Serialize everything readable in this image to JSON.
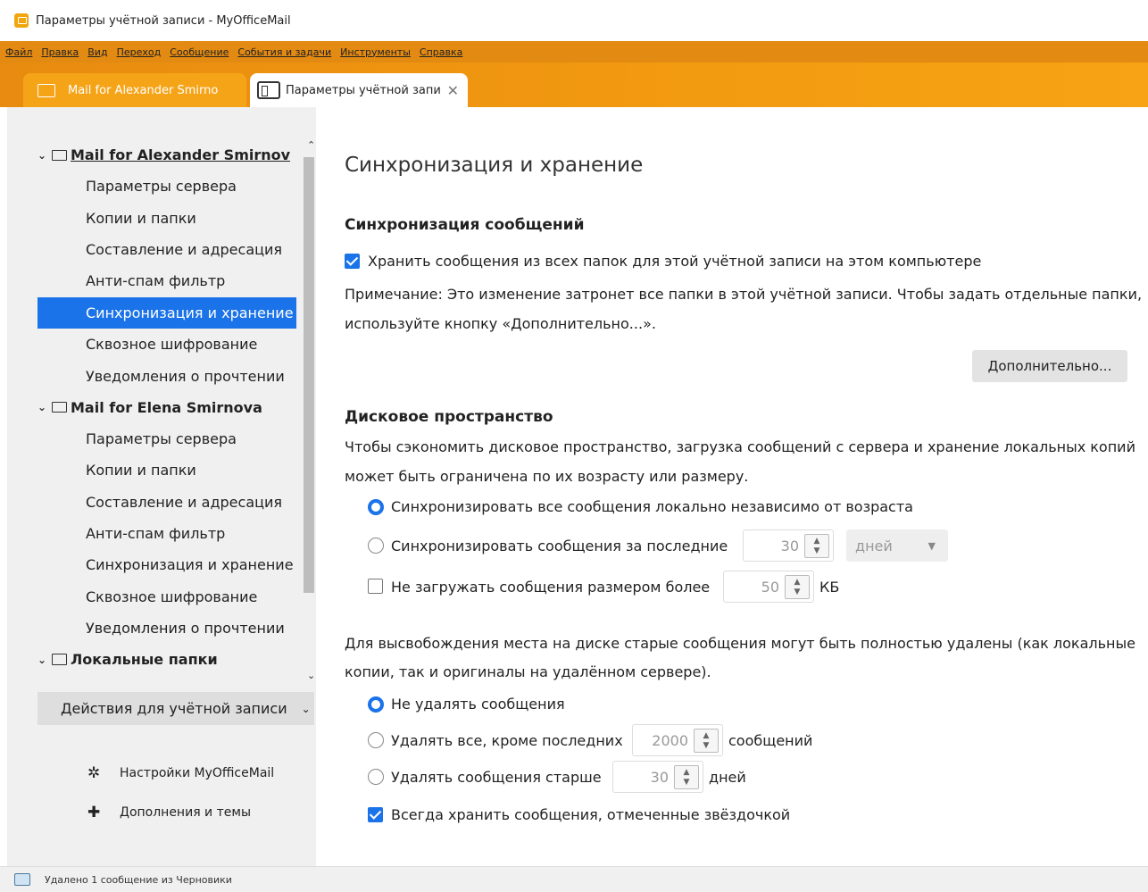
{
  "window": {
    "title": "Параметры учётной записи - MyOfficeMail"
  },
  "menu": [
    "Файл",
    "Правка",
    "Вид",
    "Переход",
    "Сообщение",
    "События и задачи",
    "Инструменты",
    "Справка"
  ],
  "tabs": [
    {
      "label": "Mail for Alexander Smirno"
    },
    {
      "label": "Параметры учётной запи",
      "close": "✕"
    }
  ],
  "sidebar": {
    "accounts": [
      {
        "name": "Mail for Alexander Smirnov",
        "items": [
          "Параметры сервера",
          "Копии и папки",
          "Составление и адресация",
          "Анти-спам фильтр",
          "Синхронизация и хранение",
          "Сквозное шифрование",
          "Уведомления о прочтении"
        ]
      },
      {
        "name": "Mail for Elena Smirnova",
        "items": [
          "Параметры сервера",
          "Копии и папки",
          "Составление и адресация",
          "Анти-спам фильтр",
          "Синхронизация и хранение",
          "Сквозное шифрование",
          "Уведомления о прочтении"
        ]
      },
      {
        "name": "Локальные папки",
        "items": []
      }
    ],
    "account_actions": "Действия для учётной записи",
    "footer_links": [
      {
        "label": "Настройки MyOfficeMail",
        "icon": "gear-icon"
      },
      {
        "label": "Дополнения и темы",
        "icon": "puzzle-icon"
      }
    ]
  },
  "content": {
    "title": "Синхронизация и хранение",
    "sync_section": {
      "heading": "Синхронизация сообщений",
      "keep_messages_label": "Хранить сообщения из всех папок для этой учётной записи на этом компьютере",
      "keep_messages_checked": true,
      "note_line1": "Примечание: Это изменение затронет все папки в этой учётной записи. Чтобы задать отдельные папки,",
      "note_line2": "используйте кнопку «Дополнительно...».",
      "advanced_button": "Дополнительно..."
    },
    "disk_section": {
      "heading": "Дисковое пространство",
      "desc_line1": "Чтобы сэкономить дисковое пространство, загрузка сообщений с сервера и хранение локальных копий",
      "desc_line2": "может быть ограничена по их возрасту или размеру.",
      "sync_all_label": "Синхронизировать все сообщения локально независимо от возраста",
      "sync_last_label": "Синхронизировать сообщения за последние",
      "sync_last_value": "30",
      "sync_last_unit": "дней",
      "size_limit_label": "Не загружать сообщения размером более",
      "size_limit_value": "50",
      "size_limit_unit": "КБ",
      "delete_desc_line1": "Для высвобождения места на диске старые сообщения могут быть полностью удалены (как локальные",
      "delete_desc_line2": "копии, так и оригиналы на удалённом сервере).",
      "no_delete_label": "Не удалять сообщения",
      "delete_except_label": "Удалять все, кроме последних",
      "delete_except_value": "2000",
      "delete_except_unit": "сообщений",
      "delete_older_label": "Удалять сообщения старше",
      "delete_older_value": "30",
      "delete_older_unit": "дней",
      "keep_starred_label": "Всегда хранить сообщения, отмеченные звёздочкой",
      "keep_starred_checked": true
    }
  },
  "status": {
    "text": "Удалено 1 сообщение из Черновики"
  },
  "colors": {
    "accent": "#1a73e8",
    "menubar": "#e38a12",
    "tabbar": "#f29a10"
  }
}
